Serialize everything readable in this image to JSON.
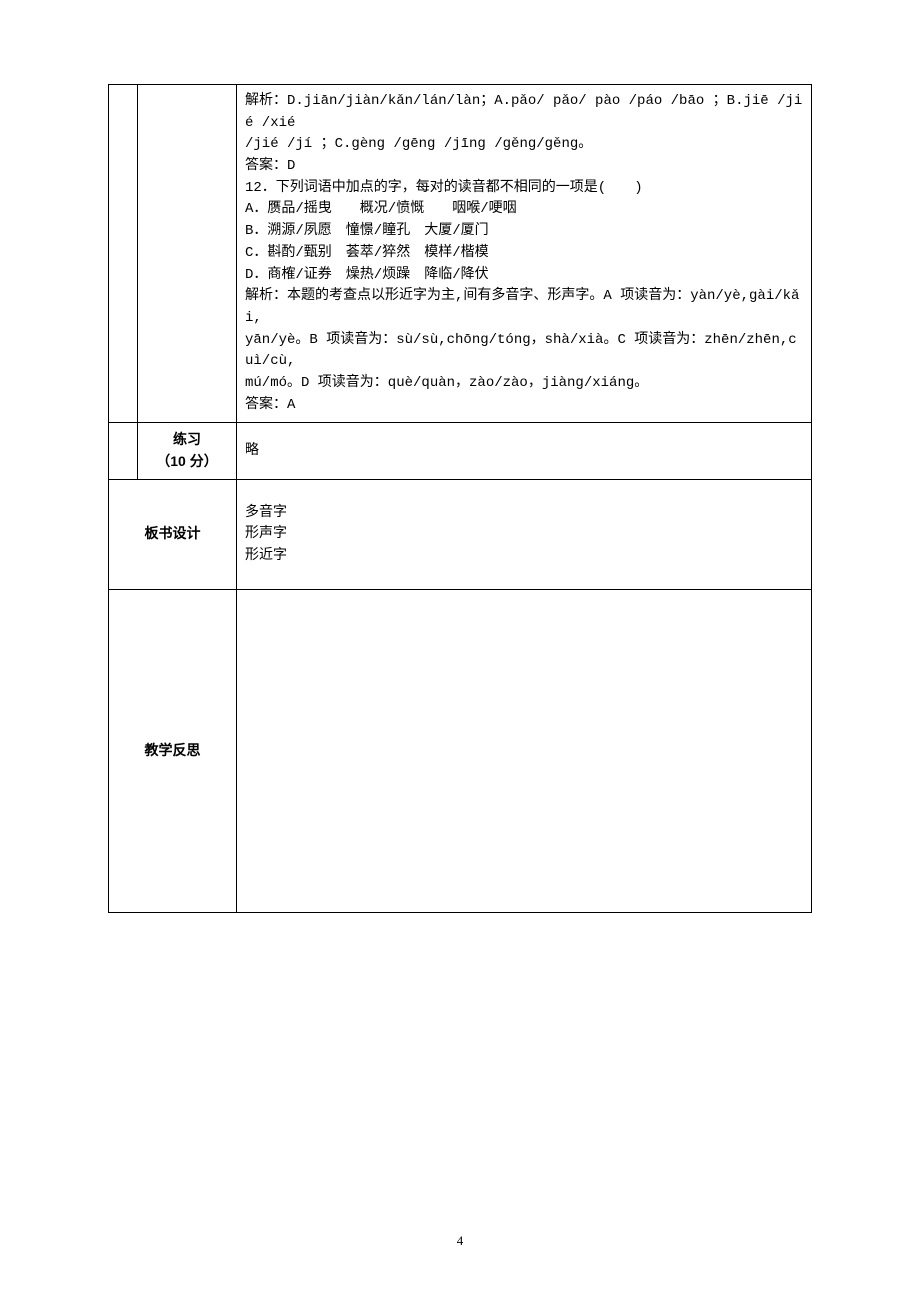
{
  "row1_label": "",
  "answer_block": {
    "l1": "解析：D.jiān/jiàn/kǎn/lán/làn；A.pǎo/ pǎo/ pào /páo /bāo ；B.jiē /jié /xié",
    "l2": "/jié /jí ；C.gèng /gēng /jīng /gěng/gěng。",
    "l3": "答案：D",
    "l4": "12．下列词语中加点的字，每对的读音都不相同的一项是(　　)",
    "l5": "A．赝品/摇曳　　概况/愤慨　　咽喉/哽咽",
    "l6": "B．溯源/夙愿　憧憬/瞳孔　大厦/厦门",
    "l7": "C．斟酌/甄别　荟萃/猝然　模样/楷模",
    "l8": "D．商榷/证券　燥热/烦躁　降临/降伏",
    "l9": "解析：本题的考查点以形近字为主,间有多音字、形声字。A 项读音为：yàn/yè,gài/kǎi,",
    "l10": "yān/yè。B 项读音为：sù/sù,chōng/tóng，shà/xià。C 项读音为：zhēn/zhēn,cuì/cù,",
    "l11": "mú/mó。D 项读音为：què/quàn，zào/zào，jiàng/xiáng。",
    "l12": "答案：A"
  },
  "practice": {
    "label1": "练习",
    "label2": "（10 分）",
    "content": "略"
  },
  "board": {
    "label": "板书设计",
    "line1": "多音字",
    "line2": "形声字",
    "line3": "形近字"
  },
  "reflect": {
    "label": "教学反思",
    "content": ""
  },
  "page_number": "4"
}
